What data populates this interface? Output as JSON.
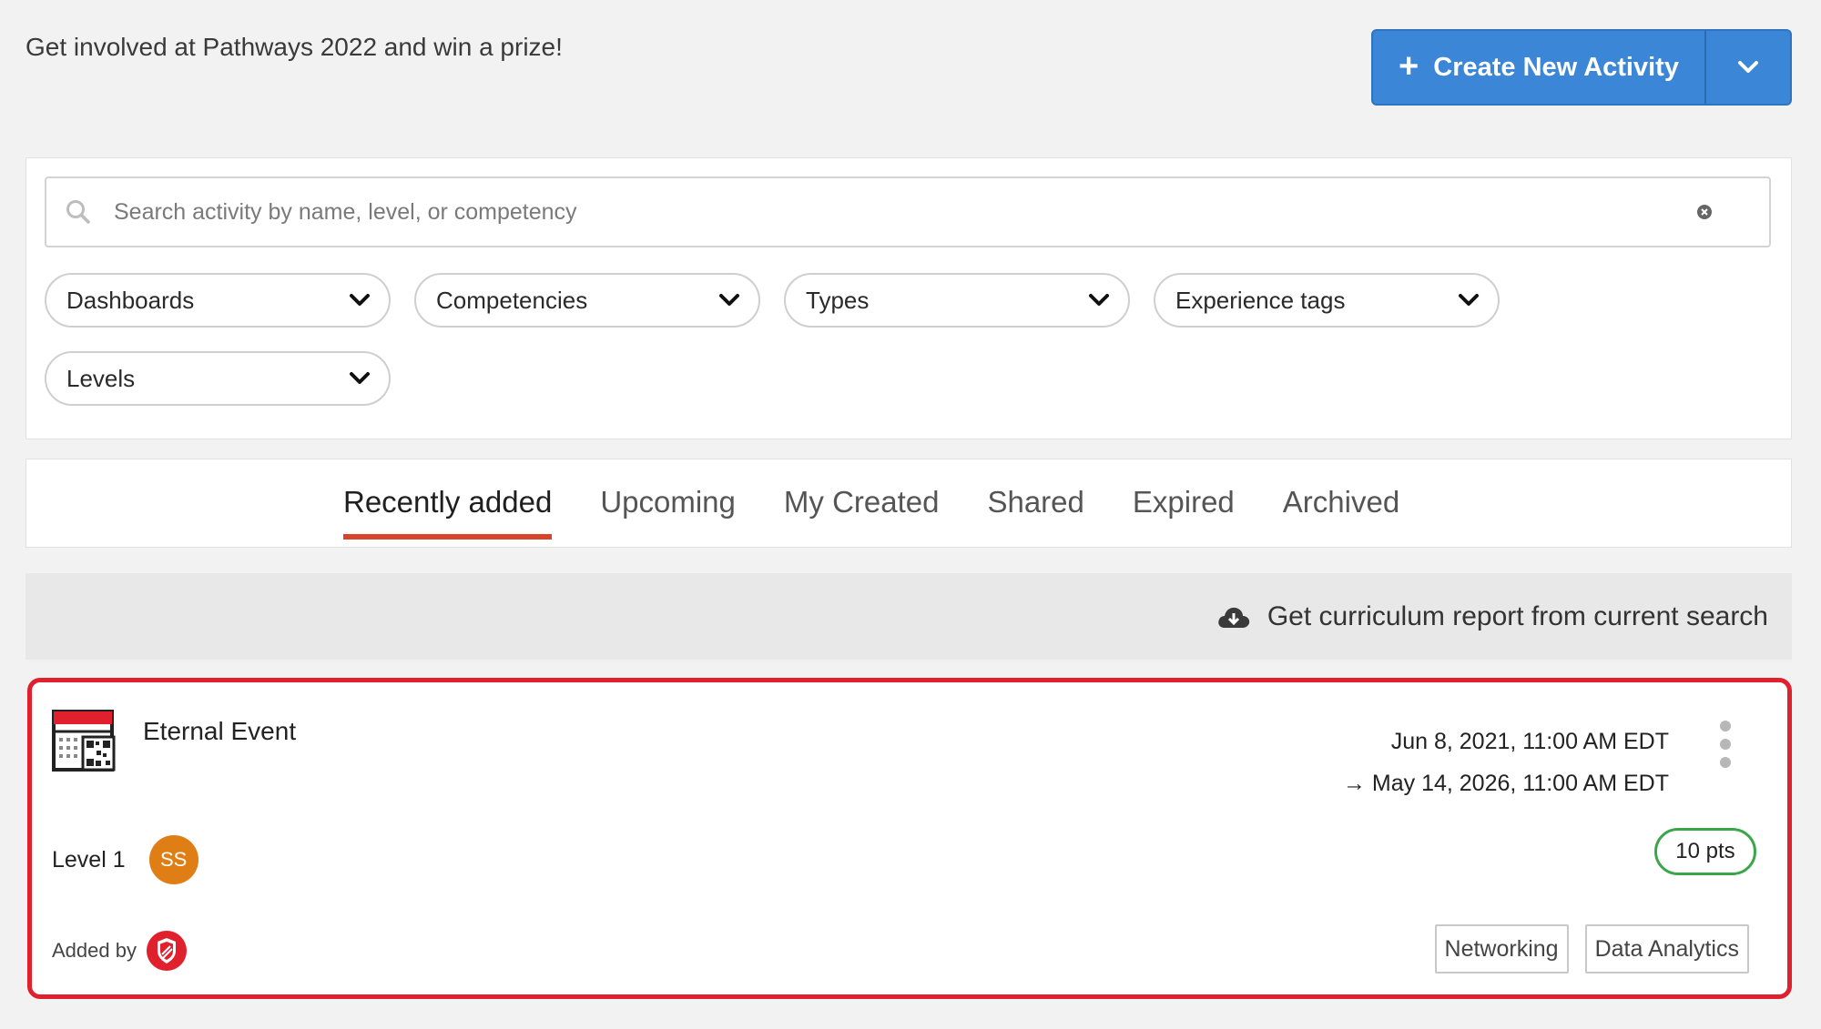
{
  "header": {
    "promo_text": "Get involved at Pathways 2022 and win a prize!",
    "create_button_label": "Create New Activity",
    "create_button_color": "#3b86d6"
  },
  "search": {
    "placeholder": "Search activity by name, level, or competency",
    "value": ""
  },
  "filters": [
    {
      "label": "Dashboards"
    },
    {
      "label": "Competencies"
    },
    {
      "label": "Types"
    },
    {
      "label": "Experience tags"
    },
    {
      "label": "Levels"
    }
  ],
  "tabs": [
    {
      "label": "Recently added",
      "active": true
    },
    {
      "label": "Upcoming"
    },
    {
      "label": "My Created"
    },
    {
      "label": "Shared"
    },
    {
      "label": "Expired"
    },
    {
      "label": "Archived"
    }
  ],
  "report": {
    "label": "Get curriculum report from current search"
  },
  "activity": {
    "title": "Eternal Event",
    "start": "Jun 8, 2021, 11:00 AM EDT",
    "end": "May 14, 2026, 11:00 AM EDT",
    "level": "Level 1",
    "avatar_initials": "SS",
    "avatar_color": "#e07e16",
    "points": "10 pts",
    "added_by_label": "Added by",
    "tags": [
      "Networking",
      "Data Analytics"
    ],
    "highlight_color": "#e0202c"
  },
  "accent_color": "#d9432a"
}
